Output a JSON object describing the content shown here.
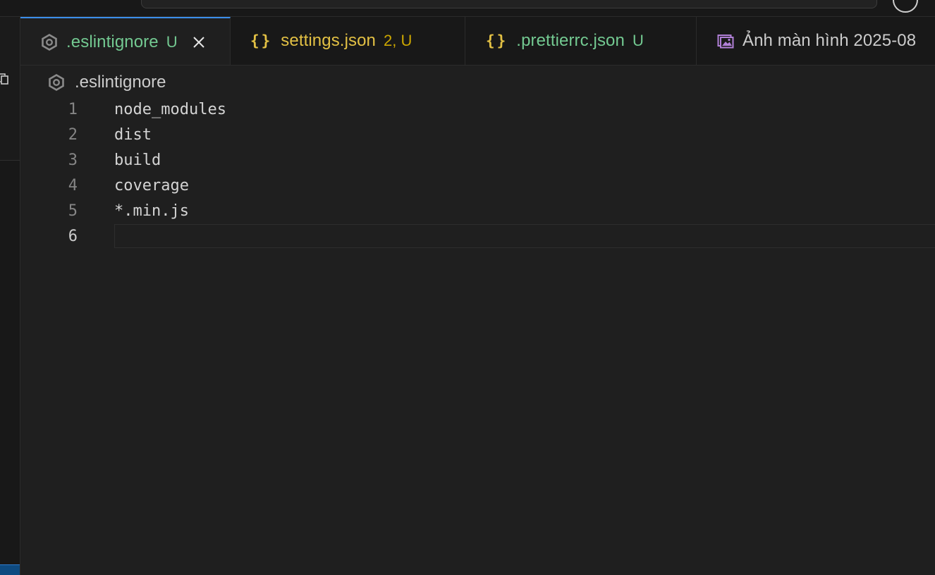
{
  "tabs": [
    {
      "name": ".eslintignore",
      "status": "U",
      "icon": "eslint-gear-icon",
      "active": true,
      "name_color": "#73c991",
      "status_color": "#73c991"
    },
    {
      "name": "settings.json",
      "status": "2, U",
      "icon": "json-braces-icon",
      "active": false,
      "name_color": "#e2c044",
      "status_color": "#cca700"
    },
    {
      "name": ".prettierrc.json",
      "status": "U",
      "icon": "json-braces-icon",
      "active": false,
      "name_color": "#73c991",
      "status_color": "#73c991"
    },
    {
      "name": "Ảnh màn hình 2025-08",
      "status": "",
      "icon": "image-file-icon",
      "active": false,
      "name_color": "#cccccc",
      "status_color": ""
    }
  ],
  "json_icon_glyph": "{}",
  "breadcrumb": {
    "file": ".eslintignore"
  },
  "editor": {
    "lines": [
      {
        "number": "1",
        "text": "node_modules"
      },
      {
        "number": "2",
        "text": "dist"
      },
      {
        "number": "3",
        "text": "build"
      },
      {
        "number": "4",
        "text": "coverage"
      },
      {
        "number": "5",
        "text": "*.min.js"
      },
      {
        "number": "6",
        "text": ""
      }
    ],
    "current_line": "6"
  },
  "colors": {
    "accent": "#3b8eea",
    "modified_untracked": "#73c991",
    "warning": "#cca700"
  }
}
